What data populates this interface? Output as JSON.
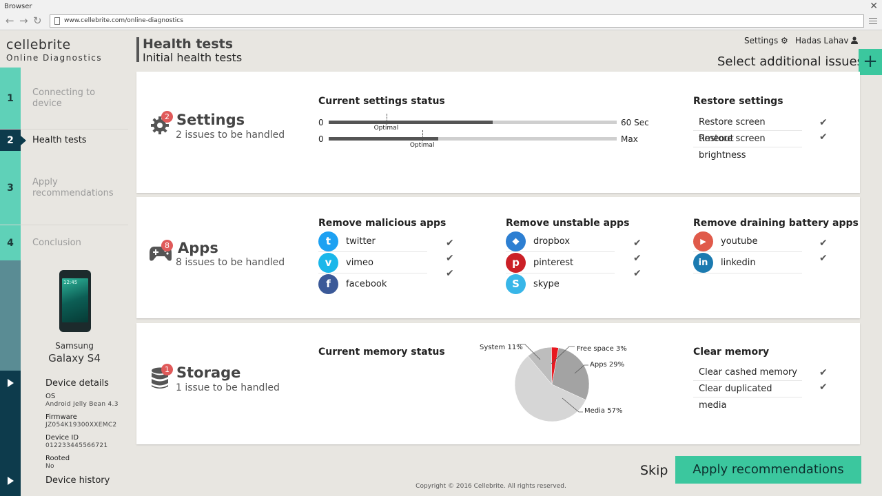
{
  "browser": {
    "window_title": "Browser",
    "url": "www.cellebrite.com/online-diagnostics"
  },
  "brand": {
    "logo": "cellebrite",
    "subtitle": "Online Diagnostics"
  },
  "header": {
    "title": "Health tests",
    "subtitle": "Initial health tests",
    "settings_label": "Settings",
    "user_name": "Hadas Lahav",
    "select_issues_label": "Select additional issues",
    "plus_label": "+"
  },
  "steps": [
    {
      "num": "1",
      "label": "Connecting to device",
      "active": false
    },
    {
      "num": "2",
      "label": "Health tests",
      "active": true
    },
    {
      "num": "3",
      "label": "Apply recommendations",
      "active": false
    },
    {
      "num": "4",
      "label": "Conclusion",
      "active": false
    }
  ],
  "device": {
    "phone_clock": "12:45",
    "maker": "Samsung",
    "model": "Galaxy S4",
    "details_label": "Device details",
    "os_label": "OS",
    "os_value": "Android Jelly Bean 4.3",
    "firmware_label": "Firmware",
    "firmware_value": "JZ054K19300XXEMC2",
    "id_label": "Device ID",
    "id_value": "012233445566721",
    "rooted_label": "Rooted",
    "rooted_value": "No",
    "history_label": "Device history"
  },
  "settings_card": {
    "badge": "2",
    "title": "Settings",
    "subtitle": "2 issues to be handled",
    "status_heading": "Current settings status",
    "slider1": {
      "min": "0",
      "max": "60 Sec",
      "value_fraction": 0.57,
      "optimal_fraction": 0.2,
      "optimal_label": "Optimal"
    },
    "slider2": {
      "min": "0",
      "max": "Max",
      "value_fraction": 0.38,
      "optimal_fraction": 0.325,
      "optimal_label": "Optimal"
    },
    "restore_heading": "Restore settings",
    "restore_items": [
      "Restore screen timeout",
      "Restore screen brightness"
    ]
  },
  "apps_card": {
    "badge": "8",
    "title": "Apps",
    "subtitle": "8 issues to be handled",
    "malicious_heading": "Remove malicious apps",
    "malicious": [
      {
        "name": "twitter",
        "icon": "twitter-icon",
        "glyph": "t",
        "color": "#1da1f2"
      },
      {
        "name": "vimeo",
        "icon": "vimeo-icon",
        "glyph": "v",
        "color": "#1ab7ea"
      },
      {
        "name": "facebook",
        "icon": "facebook-icon",
        "glyph": "f",
        "color": "#3b5998"
      }
    ],
    "unstable_heading": "Remove unstable apps",
    "unstable": [
      {
        "name": "dropbox",
        "icon": "dropbox-icon",
        "glyph": "◆",
        "color": "#2d7fd2"
      },
      {
        "name": "pinterest",
        "icon": "pinterest-icon",
        "glyph": "p",
        "color": "#cb2027"
      },
      {
        "name": "skype",
        "icon": "skype-icon",
        "glyph": "S",
        "color": "#38b6e8"
      }
    ],
    "battery_heading": "Remove draining battery apps",
    "battery": [
      {
        "name": "youtube",
        "icon": "youtube-icon",
        "glyph": "▶",
        "color": "#e05a4a"
      },
      {
        "name": "linkedin",
        "icon": "linkedin-icon",
        "glyph": "in",
        "color": "#1b7ab0"
      }
    ]
  },
  "storage_card": {
    "badge": "1",
    "title": "Storage",
    "subtitle": "1 issue to be handled",
    "memory_heading": "Current memory status",
    "clear_heading": "Clear memory",
    "clear_items": [
      "Clear cashed memory",
      "Clear duplicated media"
    ]
  },
  "chart_data": {
    "type": "pie",
    "title": "",
    "slices": [
      {
        "label": "System 11%",
        "value": 11,
        "color": "#bdbdbd"
      },
      {
        "label": "Free space 3%",
        "value": 3,
        "color": "#e8171f"
      },
      {
        "label": "Apps 29%",
        "value": 29,
        "color": "#a3a3a3"
      },
      {
        "label": "Media 57%",
        "value": 57,
        "color": "#d6d6d6"
      }
    ]
  },
  "footer": {
    "skip_label": "Skip",
    "apply_label": "Apply recommendations",
    "copyright": "Copyright © 2016 Cellebrite. All rights reserved."
  }
}
